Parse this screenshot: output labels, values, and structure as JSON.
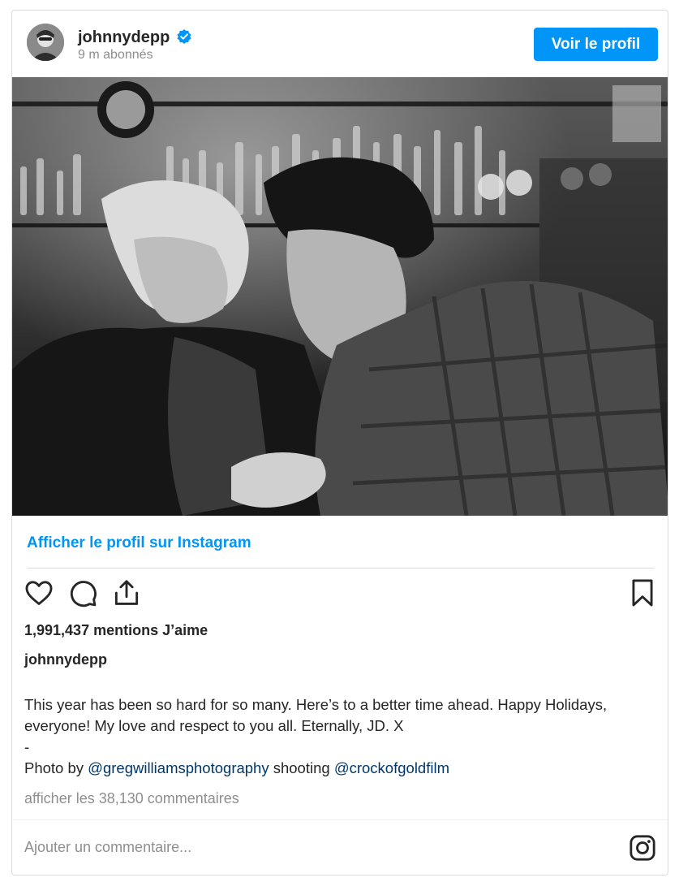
{
  "header": {
    "username": "johnnydepp",
    "followers": "9 m abonnés",
    "profile_button": "Voir le profil",
    "verified_icon": "verified-badge-icon",
    "accent_color": "#0095f6"
  },
  "post": {
    "photo_description_icon": "bw-photo-two-men-at-bar",
    "view_on_instagram": "Afficher le profil sur Instagram",
    "likes": "1,991,437 mentions J’aime",
    "caption_user": "johnnydepp",
    "caption_line1": "This year has been so hard for so many. Here’s to a better time ahead. Happy Holidays, everyone! My love and respect to you all. Eternally, JD. X",
    "caption_dash": "-",
    "caption_photo_by": "Photo by ",
    "mention1": "@gregwilliamsphotography",
    "caption_shooting": " shooting ",
    "mention2": "@crockofgoldfilm",
    "view_comments": "afficher les 38,130 commentaires"
  },
  "comment": {
    "placeholder": "Ajouter un commentaire..."
  },
  "icons": [
    "heart-icon",
    "comment-icon",
    "share-icon",
    "bookmark-icon",
    "instagram-icon"
  ]
}
